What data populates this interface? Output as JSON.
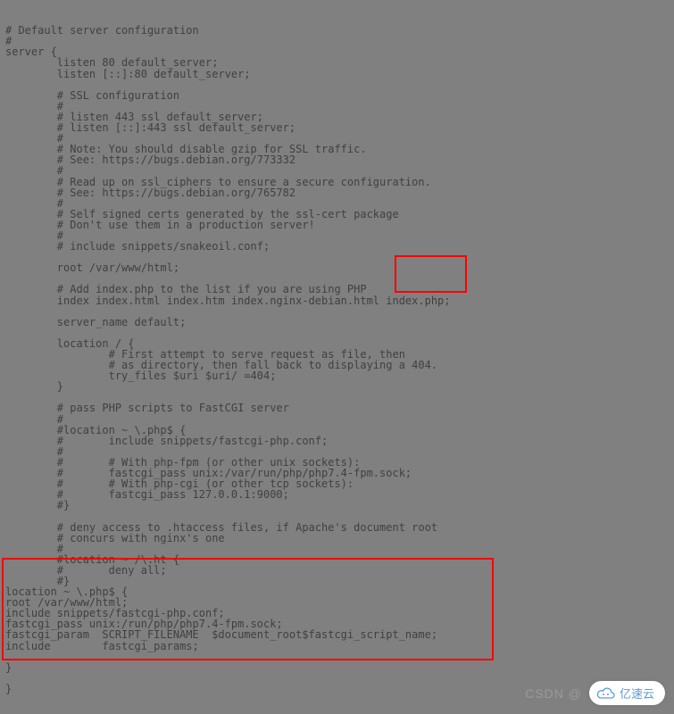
{
  "config": {
    "lines": [
      "# Default server configuration",
      "#",
      "server {",
      "        listen 80 default_server;",
      "        listen [::]:80 default_server;",
      "",
      "        # SSL configuration",
      "        #",
      "        # listen 443 ssl default_server;",
      "        # listen [::]:443 ssl default_server;",
      "        #",
      "        # Note: You should disable gzip for SSL traffic.",
      "        # See: https://bugs.debian.org/773332",
      "        #",
      "        # Read up on ssl_ciphers to ensure a secure configuration.",
      "        # See: https://bugs.debian.org/765782",
      "        #",
      "        # Self signed certs generated by the ssl-cert package",
      "        # Don't use them in a production server!",
      "        #",
      "        # include snippets/snakeoil.conf;",
      "",
      "        root /var/www/html;",
      "",
      "        # Add index.php to the list if you are using PHP",
      "        index index.html index.htm index.nginx-debian.html index.php;",
      "",
      "        server_name default;",
      "",
      "        location / {",
      "                # First attempt to serve request as file, then",
      "                # as directory, then fall back to displaying a 404.",
      "                try_files $uri $uri/ =404;",
      "        }",
      "",
      "        # pass PHP scripts to FastCGI server",
      "        #",
      "        #location ~ \\.php$ {",
      "        #       include snippets/fastcgi-php.conf;",
      "        #",
      "        #       # With php-fpm (or other unix sockets):",
      "        #       fastcgi_pass unix:/var/run/php/php7.4-fpm.sock;",
      "        #       # With php-cgi (or other tcp sockets):",
      "        #       fastcgi_pass 127.0.0.1:9000;",
      "        #}",
      "",
      "        # deny access to .htaccess files, if Apache's document root",
      "        # concurs with nginx's one",
      "        #",
      "        #location ~ /\\.ht {",
      "        #       deny all;",
      "        #}",
      "location ~ \\.php$ {",
      "root /var/www/html;",
      "include snippets/fastcgi-php.conf;",
      "fastcgi_pass unix:/run/php/php7.4-fpm.sock;",
      "fastcgi_param  SCRIPT_FILENAME  $document_root$fastcgi_script_name;",
      "include        fastcgi_params;",
      "",
      "}",
      "",
      "}"
    ]
  },
  "watermark": {
    "csdn": "CSDN @",
    "brand": "亿速云"
  }
}
